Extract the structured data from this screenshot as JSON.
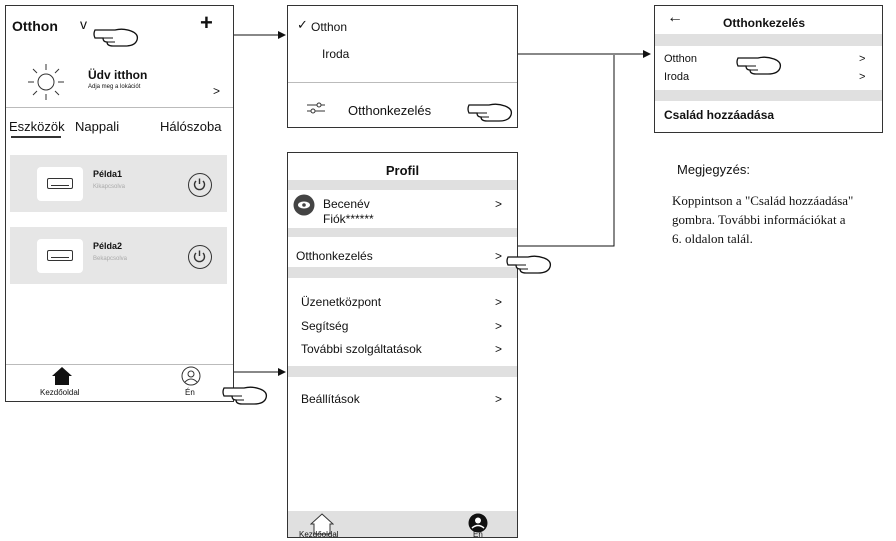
{
  "home": {
    "title": "Otthon",
    "dropdown_glyph": "v",
    "add_glyph": "+",
    "welcome_title": "Üdv itthon",
    "welcome_sub": "Adja meg a lokációt",
    "arrow": ">",
    "tabs": [
      "Eszközök",
      "Nappali",
      "Hálószoba"
    ],
    "devices": [
      {
        "name": "Példa1",
        "status": "Kikapcsolva"
      },
      {
        "name": "Példa2",
        "status": "Bekapcsolva"
      }
    ],
    "nav_home": "Kezdőoldal",
    "nav_me": "Én"
  },
  "dropdown": {
    "check": "✓",
    "items": [
      "Otthon",
      "Iroda"
    ],
    "manage": "Otthonkezelés"
  },
  "manage": {
    "back": "←",
    "title": "Otthonkezelés",
    "homes": [
      "Otthon",
      "Iroda"
    ],
    "arrow": ">",
    "add_family": "Család hozzáadása"
  },
  "profile": {
    "title": "Profil",
    "nickname": "Becenév",
    "account": "Fiók******",
    "arrow": ">",
    "manage": "Otthonkezelés",
    "messages": "Üzenetközpont",
    "help": "Segítség",
    "services": "További szolgáltatások",
    "settings": "Beállítások",
    "nav_home": "Kezdőoldal",
    "nav_me": "Én"
  },
  "note": {
    "heading": "Megjegyzés:",
    "lines": [
      "Koppintson a \"Család hozzáadása\"",
      "gombra. További információkat a",
      "6. oldalon talál."
    ]
  },
  "icons": [
    "sun-icon",
    "power-icon",
    "ac-unit-icon",
    "home-icon",
    "person-icon",
    "settings-slider-icon",
    "pointing-hand-icon",
    "back-arrow-icon",
    "checkmark-icon"
  ]
}
